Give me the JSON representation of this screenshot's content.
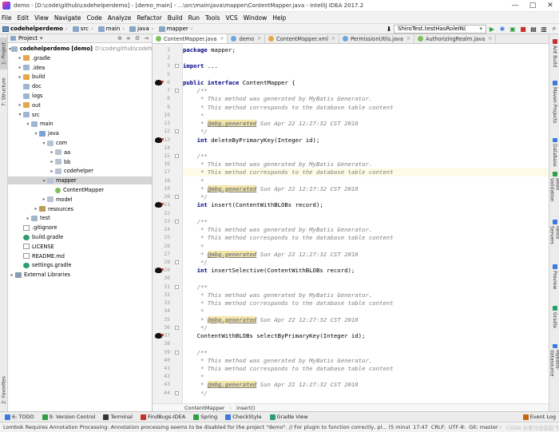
{
  "window": {
    "title": "demo - [D:\\code\\github\\codehelperdemo] - [demo_main] - ...\\src\\main\\java\\mapper\\ContentMapper.java - IntelliJ IDEA 2017.2",
    "controls": [
      "—",
      "□",
      "✕"
    ]
  },
  "menu": [
    "File",
    "Edit",
    "View",
    "Navigate",
    "Code",
    "Analyze",
    "Refactor",
    "Build",
    "Run",
    "Tools",
    "VCS",
    "Window",
    "Help"
  ],
  "breadcrumb": [
    "codehelperdemo",
    "src",
    "main",
    "java",
    "mapper"
  ],
  "run_config": {
    "label": "ShiroTest.testHasRoleIN("
  },
  "left_tabs": [
    "1: Project",
    "7: Structure",
    "2: Favorites"
  ],
  "right_tabs": [
    "Ant Build",
    "Maven Projects",
    "Database",
    "Bean Validation",
    "Redis Servers",
    "Preview",
    "Gradle",
    "Mybatis-datasource"
  ],
  "project_panel": {
    "header": "Project",
    "tree": [
      {
        "label": "codehelperdemo [demo]",
        "extra": "D:\\code\\github\\codehelperdemo",
        "depth": 0,
        "arrow": "▾",
        "icon": "folder",
        "bold": true
      },
      {
        "label": ".gradle",
        "depth": 1,
        "arrow": "▸",
        "icon": "orange"
      },
      {
        "label": ".idea",
        "depth": 1,
        "arrow": "▸",
        "icon": "folder"
      },
      {
        "label": "build",
        "depth": 1,
        "arrow": "▸",
        "icon": "orange"
      },
      {
        "label": "doc",
        "depth": 1,
        "arrow": "",
        "icon": "folder"
      },
      {
        "label": "logs",
        "depth": 1,
        "arrow": "",
        "icon": "folder"
      },
      {
        "label": "out",
        "depth": 1,
        "arrow": "▸",
        "icon": "orange"
      },
      {
        "label": "src",
        "depth": 1,
        "arrow": "▾",
        "icon": "folder"
      },
      {
        "label": "main",
        "depth": 2,
        "arrow": "▾",
        "icon": "folder"
      },
      {
        "label": "java",
        "depth": 3,
        "arrow": "▾",
        "icon": "src"
      },
      {
        "label": "com",
        "depth": 4,
        "arrow": "▾",
        "icon": "pkg"
      },
      {
        "label": "aa",
        "depth": 5,
        "arrow": "▸",
        "icon": "pkg"
      },
      {
        "label": "bb",
        "depth": 5,
        "arrow": "▸",
        "icon": "pkg"
      },
      {
        "label": "codehelper",
        "depth": 5,
        "arrow": "▸",
        "icon": "pkg"
      },
      {
        "label": "mapper",
        "depth": 4,
        "arrow": "▾",
        "icon": "pkg",
        "selected": true
      },
      {
        "label": "ContentMapper",
        "depth": 5,
        "arrow": "",
        "icon": "interface"
      },
      {
        "label": "model",
        "depth": 4,
        "arrow": "▸",
        "icon": "pkg"
      },
      {
        "label": "resources",
        "depth": 3,
        "arrow": "▸",
        "icon": "res"
      },
      {
        "label": "test",
        "depth": 2,
        "arrow": "▸",
        "icon": "folder"
      },
      {
        "label": ".gitignore",
        "depth": 1,
        "arrow": "",
        "icon": "file"
      },
      {
        "label": "build.gradle",
        "depth": 1,
        "arrow": "",
        "icon": "gradle"
      },
      {
        "label": "LICENSE",
        "depth": 1,
        "arrow": "",
        "icon": "file"
      },
      {
        "label": "README.md",
        "depth": 1,
        "arrow": "",
        "icon": "file"
      },
      {
        "label": "settings.gradle",
        "depth": 1,
        "arrow": "",
        "icon": "gradle"
      },
      {
        "label": "External Libraries",
        "depth": 0,
        "arrow": "▸",
        "icon": "lib"
      }
    ]
  },
  "editor_tabs": [
    {
      "label": "ContentMapper.java",
      "color": "#7fbf5c",
      "active": true
    },
    {
      "label": "demo",
      "color": "#6ea5df"
    },
    {
      "label": "ContentMapper.xml",
      "color": "#e5a74a"
    },
    {
      "label": "PermissionUtils.java",
      "color": "#6ea5df"
    },
    {
      "label": "AuthorizingRealm.java",
      "color": "#7fbf5c"
    }
  ],
  "code": {
    "lines": [
      {
        "n": "1",
        "t": "package mapper;"
      },
      {
        "n": "2",
        "t": ""
      },
      {
        "n": "3",
        "t": "import ..."
      },
      {
        "n": "5",
        "t": ""
      },
      {
        "n": "6",
        "t": "public interface ContentMapper {",
        "marker": true
      },
      {
        "n": "7",
        "t": "    /**"
      },
      {
        "n": "8",
        "t": "     * This method was generated by MyBatis Generator."
      },
      {
        "n": "9",
        "t": "     * This method corresponds to the database table content"
      },
      {
        "n": "10",
        "t": "     *"
      },
      {
        "n": "11",
        "t": "     * @mbg.generated Sun Apr 22 12:27:32 CST 2018"
      },
      {
        "n": "12",
        "t": "     */"
      },
      {
        "n": "13",
        "t": "    int deleteByPrimaryKey(Integer id);",
        "marker": true
      },
      {
        "n": "14",
        "t": ""
      },
      {
        "n": "15",
        "t": "    /**"
      },
      {
        "n": "16",
        "t": "     * This method was generated by MyBatis Generator."
      },
      {
        "n": "17",
        "t": "     * This method corresponds to the database table content",
        "hl": true
      },
      {
        "n": "18",
        "t": "     *"
      },
      {
        "n": "19",
        "t": "     * @mbg.generated Sun Apr 22 12:27:32 CST 2018"
      },
      {
        "n": "20",
        "t": "     */"
      },
      {
        "n": "21",
        "t": "    int insert(ContentWithBLOBs record);",
        "marker": true
      },
      {
        "n": "22",
        "t": ""
      },
      {
        "n": "23",
        "t": "    /**"
      },
      {
        "n": "24",
        "t": "     * This method was generated by MyBatis Generator."
      },
      {
        "n": "25",
        "t": "     * This method corresponds to the database table content"
      },
      {
        "n": "26",
        "t": "     *"
      },
      {
        "n": "27",
        "t": "     * @mbg.generated Sun Apr 22 12:27:32 CST 2018"
      },
      {
        "n": "28",
        "t": "     */"
      },
      {
        "n": "29",
        "t": "    int insertSelective(ContentWithBLOBs record);",
        "marker": true
      },
      {
        "n": "30",
        "t": ""
      },
      {
        "n": "31",
        "t": "    /**"
      },
      {
        "n": "32",
        "t": "     * This method was generated by MyBatis Generator."
      },
      {
        "n": "33",
        "t": "     * This method corresponds to the database table content"
      },
      {
        "n": "34",
        "t": "     *"
      },
      {
        "n": "35",
        "t": "     * @mbg.generated Sun Apr 22 12:27:32 CST 2018"
      },
      {
        "n": "36",
        "t": "     */"
      },
      {
        "n": "37",
        "t": "    ContentWithBLOBs selectByPrimaryKey(Integer id);",
        "marker": true
      },
      {
        "n": "38",
        "t": ""
      },
      {
        "n": "39",
        "t": "    /**"
      },
      {
        "n": "40",
        "t": "     * This method was generated by MyBatis Generator."
      },
      {
        "n": "41",
        "t": "     * This method corresponds to the database table content"
      },
      {
        "n": "42",
        "t": "     *"
      },
      {
        "n": "43",
        "t": "     * @mbg.generated Sun Apr 22 12:27:32 CST 2018"
      },
      {
        "n": "44",
        "t": "     */"
      }
    ]
  },
  "code_breadcrumb": [
    "ContentMapper",
    "insert()"
  ],
  "tool_tabs": [
    "6: TODO",
    "9: Version Control",
    "Terminal",
    "FindBugs-IDEA",
    "Spring",
    "CheckStyle",
    "Gradle View"
  ],
  "event_log": "Event Log",
  "status": {
    "message": "Lombok Requires Annotation Processing: Annotation processing seems to be disabled for the project \"demo\". // For plugin to function correctly, pl... (5 minutes ago)",
    "position": "17:47",
    "line_sep": "CRLF:",
    "encoding": "UTF-8:",
    "git": "Git: master :",
    "watermark": "CSDN @老马也会起飞"
  }
}
